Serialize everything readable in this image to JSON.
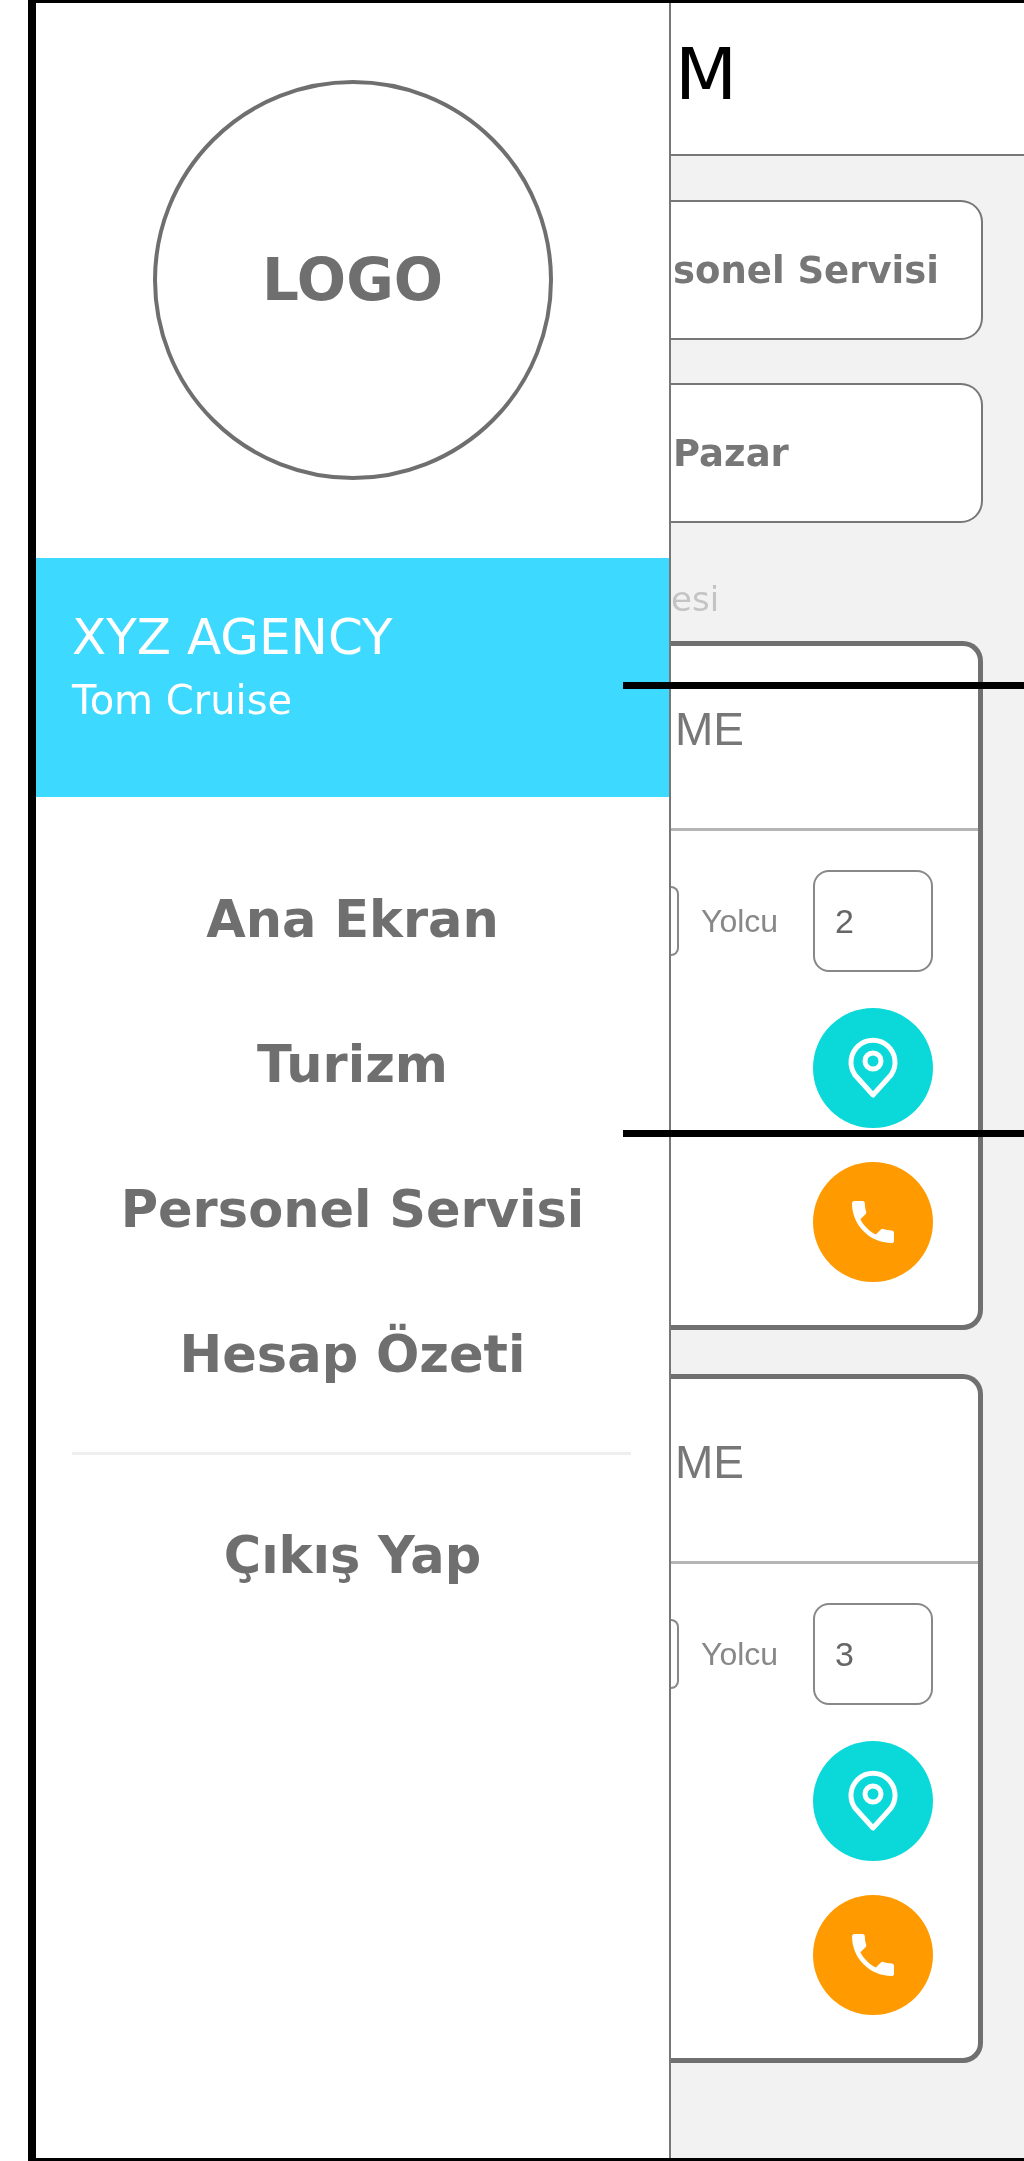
{
  "drawer": {
    "logo": "LOGO",
    "account": {
      "agency": "XYZ AGENCY",
      "user": "Tom Cruise"
    },
    "menu": [
      {
        "label": "Ana Ekran"
      },
      {
        "label": "Turizm"
      },
      {
        "label": "Personel Servisi"
      },
      {
        "label": "Hesap Özeti"
      }
    ],
    "logout": "Çıkış Yap"
  },
  "main": {
    "title": "M",
    "fields": [
      "sonel Servisi",
      "Pazar"
    ],
    "section_label": "esi",
    "cards": [
      {
        "title": "ME",
        "passenger_label": "Yolcu",
        "passengers": "2"
      },
      {
        "title": "ME",
        "passenger_label": "Yolcu",
        "passengers": "3"
      }
    ]
  }
}
